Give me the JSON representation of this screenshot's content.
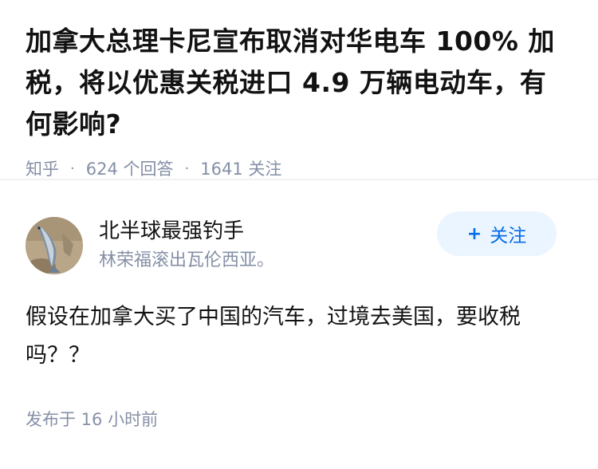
{
  "question": {
    "title": "加拿大总理卡尼宣布取消对华电车 100% 加税，将以优惠关税进口 4.9 万辆电动车，有何影响?",
    "source": "知乎",
    "answers_count": "624 个回答",
    "followers_count": "1641 关注"
  },
  "answer": {
    "author_name": "北半球最强钓手",
    "author_bio": "林荣福滚出瓦伦西亚。",
    "follow_plus": "+",
    "follow_label": "关注",
    "content": "假设在加拿大买了中国的汽车，过境去美国，要收税吗？？",
    "published": "发布于 16 小时前"
  },
  "icons": {
    "avatar": "fish-photo-avatar"
  },
  "colors": {
    "meta_gray": "#8590a6",
    "accent_blue": "#056de8",
    "follow_bg": "#ebf5ff"
  }
}
